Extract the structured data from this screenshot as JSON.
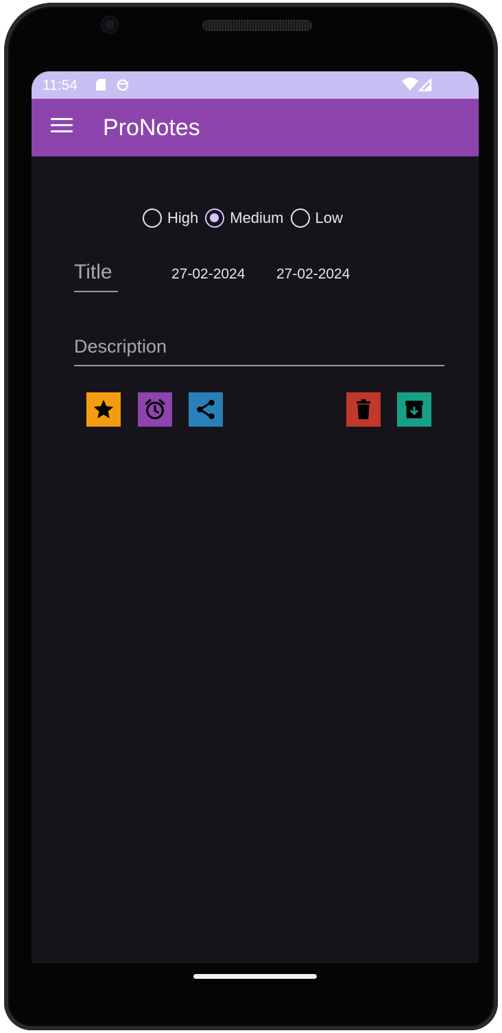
{
  "status_bar": {
    "time": "11:54",
    "background": "#c9bff2",
    "icons": [
      "sd-card-icon",
      "sync-icon",
      "wifi-icon",
      "signal-icon"
    ]
  },
  "app_bar": {
    "title": "ProNotes",
    "background": "#8e44ad",
    "menu_icon": "menu-icon"
  },
  "priority": {
    "options": [
      {
        "label": "High",
        "checked": false
      },
      {
        "label": "Medium",
        "checked": true
      },
      {
        "label": "Low",
        "checked": false
      }
    ],
    "selected": "Medium",
    "accent": "#d3c6ff"
  },
  "form": {
    "title_placeholder": "Title",
    "start_date": "27-02-2024",
    "end_date": "27-02-2024",
    "description_placeholder": "Description"
  },
  "actions": [
    {
      "name": "favorite",
      "icon": "star-icon",
      "color": "#f39c12"
    },
    {
      "name": "reminder",
      "icon": "alarm-clock-icon",
      "color": "#8e44ad"
    },
    {
      "name": "share",
      "icon": "share-icon",
      "color": "#2980b9"
    },
    {
      "name": "delete",
      "icon": "trash-icon",
      "color": "#c0392b"
    },
    {
      "name": "archive",
      "icon": "archive-icon",
      "color": "#16a085"
    }
  ],
  "theme": {
    "screen_background": "#16141a",
    "text_primary": "#e8e8e8",
    "text_hint": "#a8a8a8"
  }
}
